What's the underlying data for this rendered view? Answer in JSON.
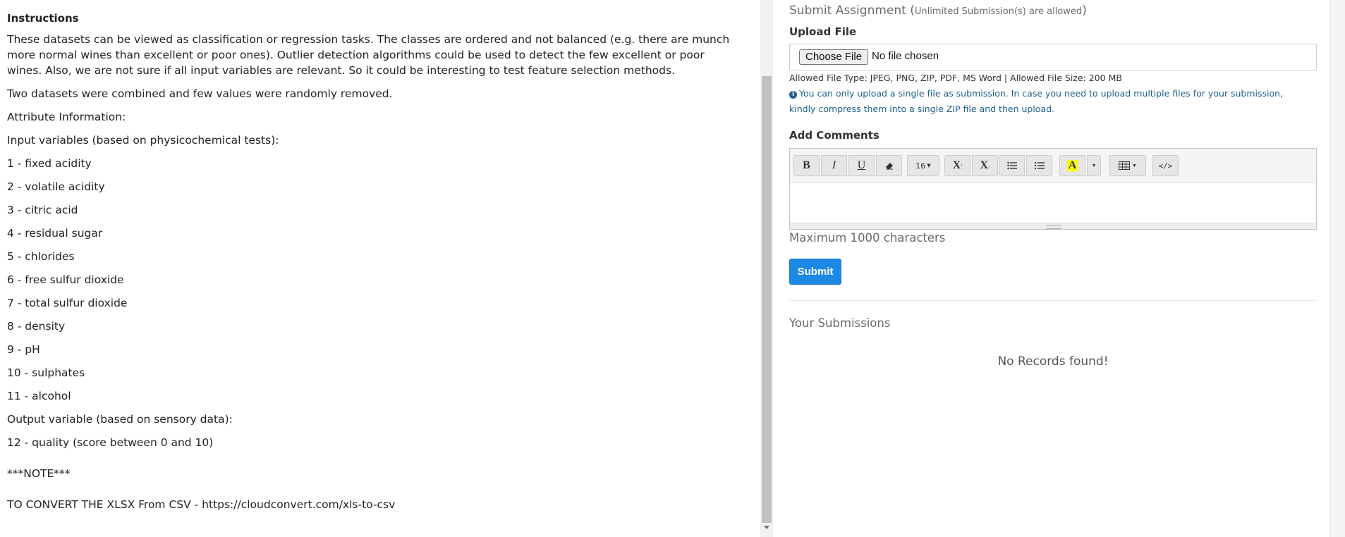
{
  "instructions": {
    "title": "Instructions",
    "paragraph1": "These datasets can be viewed as classification or regression tasks. The classes are ordered and not balanced (e.g. there are munch more normal wines than excellent or poor ones). Outlier detection algorithms could be used to detect the few excellent or poor wines. Also, we are not sure if all input variables are relevant. So it could be interesting to test feature selection methods.",
    "paragraph2": "Two datasets were combined and few values were randomly removed.",
    "attribute_info": "Attribute Information:",
    "input_vars": "Input variables (based on physicochemical tests):",
    "attributes": [
      "1 - fixed acidity",
      "2 - volatile acidity",
      "3 - citric acid",
      "4 - residual sugar",
      "5 - chlorides",
      "6 - free sulfur dioxide",
      "7 - total sulfur dioxide",
      "8 - density",
      "9 - pH",
      "10 - sulphates",
      "11 - alcohol"
    ],
    "output_var": "Output variable (based on sensory data):",
    "output_attr": "12 - quality (score between 0 and 10)",
    "note": "***NOTE***",
    "convert": "TO CONVERT THE XLSX From CSV - https://cloudconvert.com/xls-to-csv"
  },
  "submit": {
    "title": "Submit Assignment (",
    "subtitle": "Unlimited Submission(s) are allowed",
    "title_close": ")",
    "upload_label": "Upload File",
    "choose_file": "Choose File",
    "no_file": "No file chosen",
    "allowed": "Allowed File Type: JPEG, PNG, ZIP, PDF, MS Word | Allowed File Size: 200 MB",
    "info": "You can only upload a single file as submission. In case you need to upload multiple files for your submission, kindly compress them into a single ZIP file and then upload.",
    "comments_label": "Add Comments",
    "font_size": "16",
    "max_chars": "Maximum 1000 characters",
    "submit_button": "Submit",
    "your_submissions": "Your Submissions",
    "no_records": "No Records found!"
  },
  "icons": {
    "bold": "bold-icon",
    "italic": "italic-icon",
    "underline": "underline-icon",
    "eraser": "eraser-icon",
    "superscript": "superscript-icon",
    "subscript": "subscript-icon",
    "bullets": "unordered-list-icon",
    "numbers": "ordered-list-icon",
    "color": "text-color-icon",
    "table": "table-icon",
    "code": "code-view-icon",
    "info": "info-icon"
  },
  "colors": {
    "accent": "#1e88e5",
    "info_text": "#1f5f8b",
    "highlight": "#ffff00"
  }
}
